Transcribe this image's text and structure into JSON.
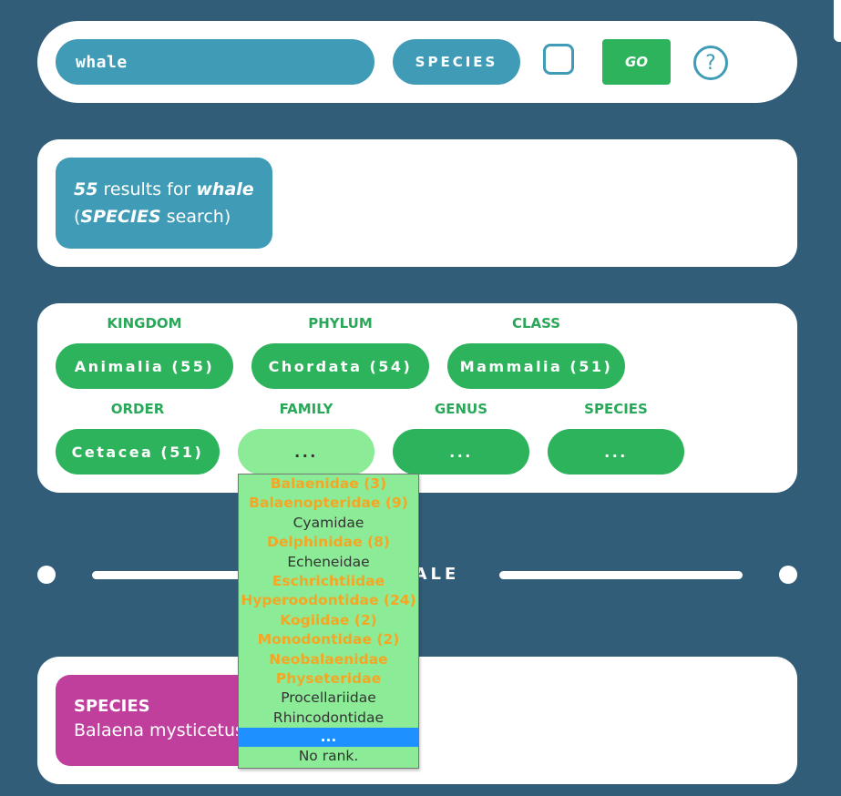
{
  "search": {
    "query": "whale",
    "type_label": "SPECIES",
    "go_label": "GO",
    "help_glyph": "?"
  },
  "results": {
    "count": "55",
    "text_mid": " results for ",
    "query": "whale",
    "open_paren": "(",
    "type": "SPECIES",
    "text_end": " search)"
  },
  "filters": {
    "kingdom": {
      "label": "KINGDOM",
      "value": "Animalia (55)"
    },
    "phylum": {
      "label": "PHYLUM",
      "value": "Chordata (54)"
    },
    "class": {
      "label": "CLASS",
      "value": "Mammalia (51)"
    },
    "order": {
      "label": "ORDER",
      "value": "Cetacea (51)"
    },
    "family": {
      "label": "FAMILY",
      "value": "..."
    },
    "genus": {
      "label": "GENUS",
      "value": "..."
    },
    "species": {
      "label": "SPECIES",
      "value": "..."
    }
  },
  "divider": {
    "label": "WHALE"
  },
  "first_result": {
    "rank": "SPECIES",
    "name": "Balaena mysticetus"
  },
  "family_dropdown": {
    "options": [
      {
        "label": "Balaenidae (3)",
        "has_results": true
      },
      {
        "label": "Balaenopteridae (9)",
        "has_results": true
      },
      {
        "label": "Cyamidae",
        "has_results": false
      },
      {
        "label": "Delphinidae (8)",
        "has_results": true
      },
      {
        "label": "Echeneidae",
        "has_results": false
      },
      {
        "label": "Eschrichtiidae",
        "has_results": true
      },
      {
        "label": "Hyperoodontidae (24)",
        "has_results": true
      },
      {
        "label": "Kogiidae (2)",
        "has_results": true
      },
      {
        "label": "Monodontidae (2)",
        "has_results": true
      },
      {
        "label": "Neobalaenidae",
        "has_results": true
      },
      {
        "label": "Physeteridae",
        "has_results": true
      },
      {
        "label": "Procellariidae",
        "has_results": false
      },
      {
        "label": "Rhincodontidae",
        "has_results": false
      },
      {
        "label": "...",
        "has_results": false,
        "selected": true
      },
      {
        "label": "No rank.",
        "has_results": false
      }
    ]
  },
  "colors": {
    "background": "#325d78",
    "teal": "#409cb6",
    "green": "#2db35c",
    "light_green": "#8ceb97",
    "orange": "#f5a623",
    "magenta": "#c03f9c",
    "select_blue": "#1e90ff"
  }
}
